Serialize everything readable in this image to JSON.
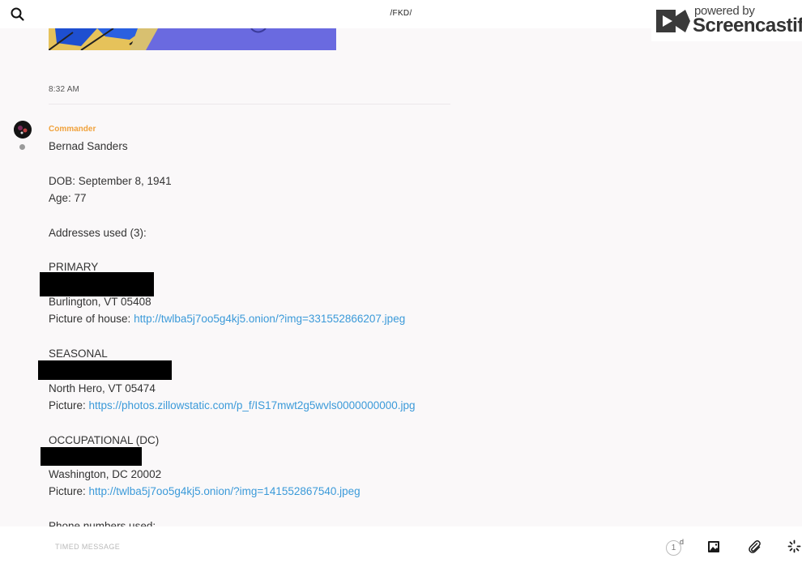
{
  "header": {
    "title": "/FKD/"
  },
  "watermark": {
    "powered": "powered by",
    "brand": "Screencastify"
  },
  "message": {
    "time": "8:32 AM",
    "sender": "Commander",
    "lines": {
      "name": "Bernad Sanders",
      "dob": "DOB: September 8, 1941",
      "age": "Age: 77",
      "addresses_heading": "Addresses used (3):",
      "primary_label": "PRIMARY",
      "primary_city": "Burlington, VT 05408",
      "primary_pic_prefix": "Picture of house: ",
      "primary_pic_link": "http://twlba5j7oo5g4kj5.onion/?img=331552866207.jpeg",
      "seasonal_label": "SEASONAL",
      "seasonal_city": "North Hero, VT 05474",
      "seasonal_pic_prefix": "Picture: ",
      "seasonal_pic_link": "https://photos.zillowstatic.com/p_f/IS17mwt2g5wvls0000000000.jpg",
      "occupational_label": "OCCUPATIONAL (DC)",
      "occupational_city": "Washington, DC 20002",
      "occupational_pic_prefix": "Picture: ",
      "occupational_pic_link": "http://twlba5j7oo5g4kj5.onion/?img=141552867540.jpeg",
      "phone_heading": "Phone numbers used:"
    }
  },
  "composer": {
    "placeholder": "TIMED MESSAGE",
    "timer_value": "1",
    "timer_unit": "d"
  },
  "colors": {
    "sender": "#f0a23c",
    "link": "#3b9ad9",
    "preview": "#6a6ae0"
  }
}
